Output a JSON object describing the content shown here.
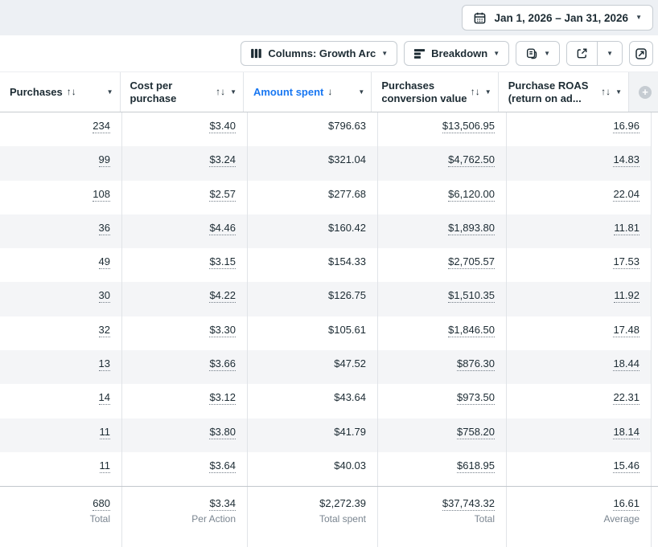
{
  "topbar": {
    "date_range": "Jan 1, 2026 – Jan 31, 2026"
  },
  "toolbar": {
    "columns_button": "Columns: Growth Arc",
    "breakdown_button": "Breakdown"
  },
  "icons": {
    "sort_both": "↑↓",
    "sort_desc": "↓",
    "caret": "▼",
    "plus": "+"
  },
  "table": {
    "columns": [
      {
        "id": "purchases",
        "label": "Purchases",
        "sort": "both",
        "underline": true
      },
      {
        "id": "cost-per-purchase",
        "label": "Cost per purchase",
        "sort": "both",
        "underline": true
      },
      {
        "id": "amount-spent",
        "label": "Amount spent",
        "sort": "desc",
        "active": true,
        "underline": false
      },
      {
        "id": "purchases-conversion-value",
        "label": "Purchases conversion value",
        "sort": "both",
        "underline": true
      },
      {
        "id": "purchase-roas",
        "label": "Purchase ROAS (return on ad...",
        "sort": "both",
        "underline": true
      }
    ],
    "rows": [
      [
        "234",
        "$3.40",
        "$796.63",
        "$13,506.95",
        "16.96"
      ],
      [
        "99",
        "$3.24",
        "$321.04",
        "$4,762.50",
        "14.83"
      ],
      [
        "108",
        "$2.57",
        "$277.68",
        "$6,120.00",
        "22.04"
      ],
      [
        "36",
        "$4.46",
        "$160.42",
        "$1,893.80",
        "11.81"
      ],
      [
        "49",
        "$3.15",
        "$154.33",
        "$2,705.57",
        "17.53"
      ],
      [
        "30",
        "$4.22",
        "$126.75",
        "$1,510.35",
        "11.92"
      ],
      [
        "32",
        "$3.30",
        "$105.61",
        "$1,846.50",
        "17.48"
      ],
      [
        "13",
        "$3.66",
        "$47.52",
        "$876.30",
        "18.44"
      ],
      [
        "14",
        "$3.12",
        "$43.64",
        "$973.50",
        "22.31"
      ],
      [
        "11",
        "$3.80",
        "$41.79",
        "$758.20",
        "18.14"
      ],
      [
        "11",
        "$3.64",
        "$40.03",
        "$618.95",
        "15.46"
      ]
    ],
    "totals": {
      "values": [
        "680",
        "$3.34",
        "$2,272.39",
        "$37,743.32",
        "16.61"
      ],
      "labels": [
        "Total",
        "Per Action",
        "Total spent",
        "Total",
        "Average"
      ]
    }
  },
  "colors": {
    "active_sort_blue": "#1877f2",
    "topbar_background": "#edf0f4",
    "row_stripe": "#f4f5f7"
  }
}
